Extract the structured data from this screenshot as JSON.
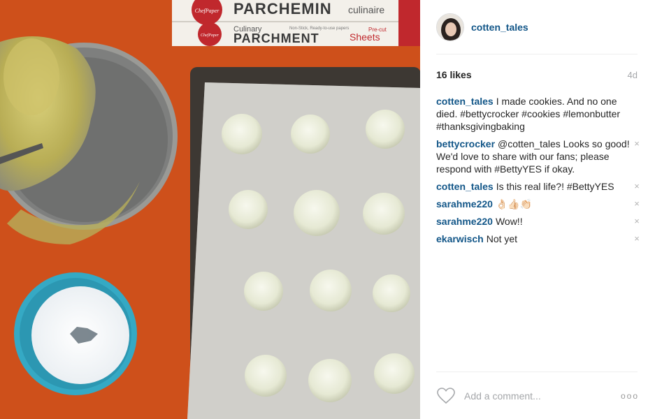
{
  "photo": {
    "alt_subject": "cookies-on-parchment-photo",
    "parchment_box": {
      "brand": "ChefPaper",
      "title_fr": "PARCHEMIN",
      "subtitle_fr": "culinaire",
      "title_en_prefix": "Culinary",
      "title_en": "PARCHMENT",
      "sheets": "Sheets",
      "small_text": "Non-Stick, Ready-to-use papers",
      "precut": "Pre-cut"
    }
  },
  "post": {
    "username": "cotten_tales",
    "likes": "16 likes",
    "age": "4d",
    "comments": [
      {
        "user": "cotten_tales",
        "text": "I made cookies. And no one died. #bettycrocker #cookies #lemonbutter #thanksgivingbaking",
        "removable": false
      },
      {
        "user": "bettycrocker",
        "text": "@cotten_tales Looks so good! We'd love to share with our fans; please respond with #BettyYES if okay.",
        "removable": true
      },
      {
        "user": "cotten_tales",
        "text": "Is this real life?! #BettyYES",
        "removable": true
      },
      {
        "user": "sarahme220",
        "text": "👌🏻👍🏻👏🏻",
        "removable": true
      },
      {
        "user": "sarahme220",
        "text": "Wow!!",
        "removable": true
      },
      {
        "user": "ekarwisch",
        "text": "Not yet",
        "removable": true
      }
    ],
    "close_glyph": "×",
    "comment_placeholder": "Add a comment...",
    "more_glyph": "ooo"
  },
  "colors": {
    "username_blue": "#125688",
    "countertop_orange": "#d2541e",
    "bowl_teal": "#35a9c4"
  }
}
